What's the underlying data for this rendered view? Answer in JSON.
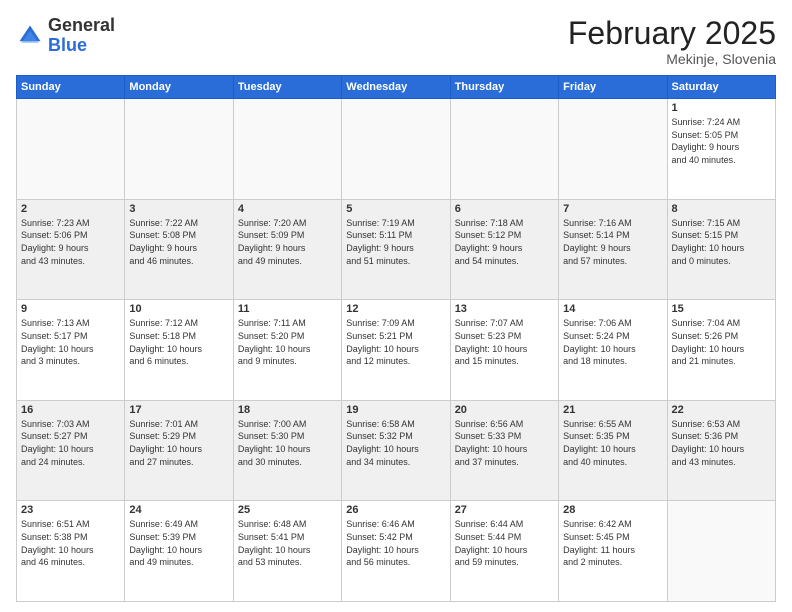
{
  "header": {
    "logo_general": "General",
    "logo_blue": "Blue",
    "month": "February 2025",
    "location": "Mekinje, Slovenia"
  },
  "days_of_week": [
    "Sunday",
    "Monday",
    "Tuesday",
    "Wednesday",
    "Thursday",
    "Friday",
    "Saturday"
  ],
  "weeks": [
    {
      "shade": false,
      "days": [
        {
          "num": "",
          "info": ""
        },
        {
          "num": "",
          "info": ""
        },
        {
          "num": "",
          "info": ""
        },
        {
          "num": "",
          "info": ""
        },
        {
          "num": "",
          "info": ""
        },
        {
          "num": "",
          "info": ""
        },
        {
          "num": "1",
          "info": "Sunrise: 7:24 AM\nSunset: 5:05 PM\nDaylight: 9 hours\nand 40 minutes."
        }
      ]
    },
    {
      "shade": true,
      "days": [
        {
          "num": "2",
          "info": "Sunrise: 7:23 AM\nSunset: 5:06 PM\nDaylight: 9 hours\nand 43 minutes."
        },
        {
          "num": "3",
          "info": "Sunrise: 7:22 AM\nSunset: 5:08 PM\nDaylight: 9 hours\nand 46 minutes."
        },
        {
          "num": "4",
          "info": "Sunrise: 7:20 AM\nSunset: 5:09 PM\nDaylight: 9 hours\nand 49 minutes."
        },
        {
          "num": "5",
          "info": "Sunrise: 7:19 AM\nSunset: 5:11 PM\nDaylight: 9 hours\nand 51 minutes."
        },
        {
          "num": "6",
          "info": "Sunrise: 7:18 AM\nSunset: 5:12 PM\nDaylight: 9 hours\nand 54 minutes."
        },
        {
          "num": "7",
          "info": "Sunrise: 7:16 AM\nSunset: 5:14 PM\nDaylight: 9 hours\nand 57 minutes."
        },
        {
          "num": "8",
          "info": "Sunrise: 7:15 AM\nSunset: 5:15 PM\nDaylight: 10 hours\nand 0 minutes."
        }
      ]
    },
    {
      "shade": false,
      "days": [
        {
          "num": "9",
          "info": "Sunrise: 7:13 AM\nSunset: 5:17 PM\nDaylight: 10 hours\nand 3 minutes."
        },
        {
          "num": "10",
          "info": "Sunrise: 7:12 AM\nSunset: 5:18 PM\nDaylight: 10 hours\nand 6 minutes."
        },
        {
          "num": "11",
          "info": "Sunrise: 7:11 AM\nSunset: 5:20 PM\nDaylight: 10 hours\nand 9 minutes."
        },
        {
          "num": "12",
          "info": "Sunrise: 7:09 AM\nSunset: 5:21 PM\nDaylight: 10 hours\nand 12 minutes."
        },
        {
          "num": "13",
          "info": "Sunrise: 7:07 AM\nSunset: 5:23 PM\nDaylight: 10 hours\nand 15 minutes."
        },
        {
          "num": "14",
          "info": "Sunrise: 7:06 AM\nSunset: 5:24 PM\nDaylight: 10 hours\nand 18 minutes."
        },
        {
          "num": "15",
          "info": "Sunrise: 7:04 AM\nSunset: 5:26 PM\nDaylight: 10 hours\nand 21 minutes."
        }
      ]
    },
    {
      "shade": true,
      "days": [
        {
          "num": "16",
          "info": "Sunrise: 7:03 AM\nSunset: 5:27 PM\nDaylight: 10 hours\nand 24 minutes."
        },
        {
          "num": "17",
          "info": "Sunrise: 7:01 AM\nSunset: 5:29 PM\nDaylight: 10 hours\nand 27 minutes."
        },
        {
          "num": "18",
          "info": "Sunrise: 7:00 AM\nSunset: 5:30 PM\nDaylight: 10 hours\nand 30 minutes."
        },
        {
          "num": "19",
          "info": "Sunrise: 6:58 AM\nSunset: 5:32 PM\nDaylight: 10 hours\nand 34 minutes."
        },
        {
          "num": "20",
          "info": "Sunrise: 6:56 AM\nSunset: 5:33 PM\nDaylight: 10 hours\nand 37 minutes."
        },
        {
          "num": "21",
          "info": "Sunrise: 6:55 AM\nSunset: 5:35 PM\nDaylight: 10 hours\nand 40 minutes."
        },
        {
          "num": "22",
          "info": "Sunrise: 6:53 AM\nSunset: 5:36 PM\nDaylight: 10 hours\nand 43 minutes."
        }
      ]
    },
    {
      "shade": false,
      "days": [
        {
          "num": "23",
          "info": "Sunrise: 6:51 AM\nSunset: 5:38 PM\nDaylight: 10 hours\nand 46 minutes."
        },
        {
          "num": "24",
          "info": "Sunrise: 6:49 AM\nSunset: 5:39 PM\nDaylight: 10 hours\nand 49 minutes."
        },
        {
          "num": "25",
          "info": "Sunrise: 6:48 AM\nSunset: 5:41 PM\nDaylight: 10 hours\nand 53 minutes."
        },
        {
          "num": "26",
          "info": "Sunrise: 6:46 AM\nSunset: 5:42 PM\nDaylight: 10 hours\nand 56 minutes."
        },
        {
          "num": "27",
          "info": "Sunrise: 6:44 AM\nSunset: 5:44 PM\nDaylight: 10 hours\nand 59 minutes."
        },
        {
          "num": "28",
          "info": "Sunrise: 6:42 AM\nSunset: 5:45 PM\nDaylight: 11 hours\nand 2 minutes."
        },
        {
          "num": "",
          "info": ""
        }
      ]
    }
  ]
}
